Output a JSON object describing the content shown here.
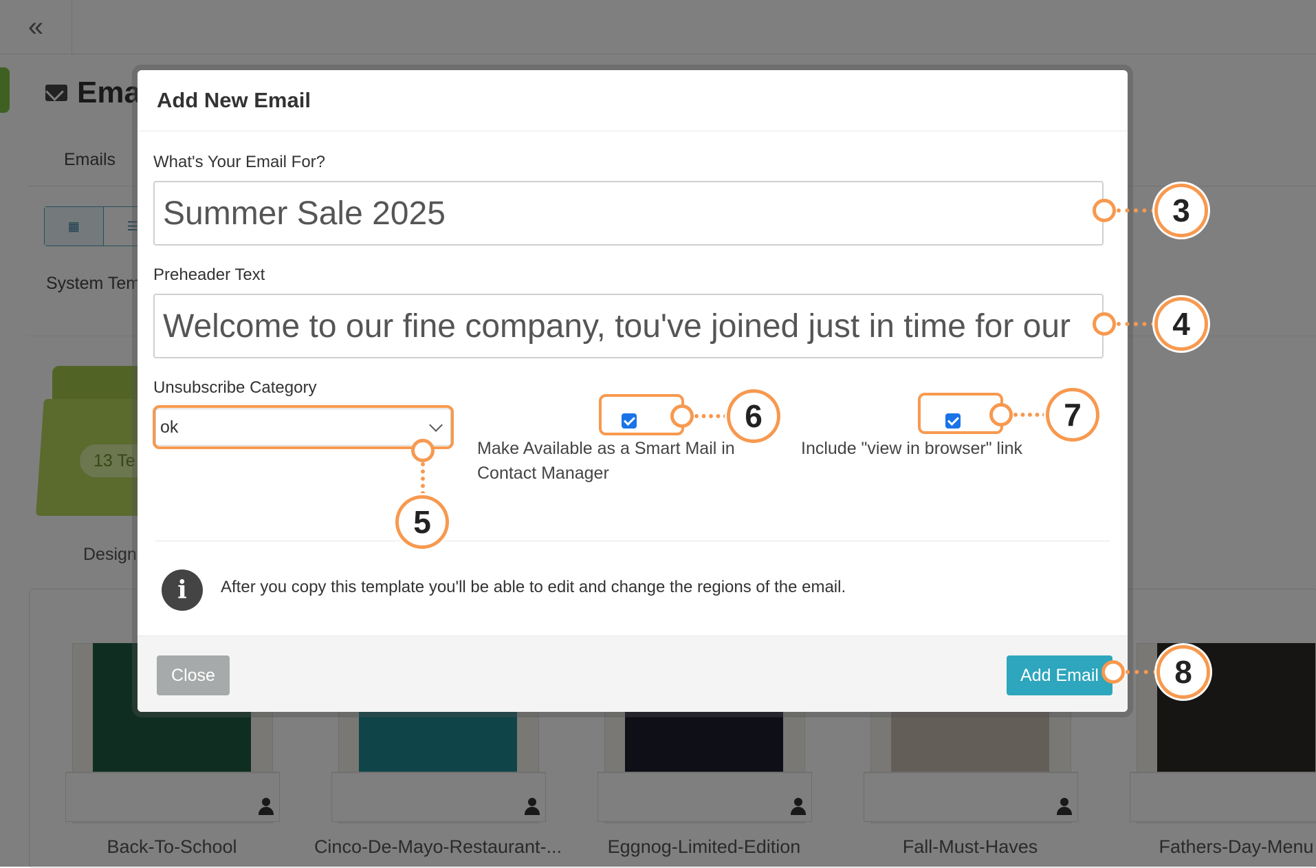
{
  "background": {
    "collapse_icon": "«",
    "page_title": "Ema",
    "tab_emails": "Emails",
    "system_templates": "System Tem",
    "folder_badge": "13 Te",
    "folder_label": "Design",
    "templates": [
      {
        "title": "Back-To-School"
      },
      {
        "title": "Cinco-De-Mayo-Restaurant-..."
      },
      {
        "title": "Eggnog-Limited-Edition"
      },
      {
        "title": "Fall-Must-Haves"
      },
      {
        "title": "Fathers-Day-Menu"
      }
    ]
  },
  "modal": {
    "title": "Add New Email",
    "email_for_label": "What's Your Email For?",
    "email_for_value": "Summer Sale 2025",
    "preheader_label": "Preheader Text",
    "preheader_value": "Welcome to our fine company, tou've joined just in time for our",
    "unsubscribe_label": "Unsubscribe Category",
    "unsubscribe_value": "ok",
    "smart_mail_label": "Make Available as a Smart Mail in Contact Manager",
    "smart_mail_checked": true,
    "view_browser_label": "Include \"view in browser\" link",
    "view_browser_checked": true,
    "info_text": "After you copy this template you'll be able to edit and change the regions of the email.",
    "close_label": "Close",
    "add_label": "Add Email"
  },
  "callouts": [
    "3",
    "4",
    "5",
    "6",
    "7",
    "8"
  ],
  "colors": {
    "accent": "#2ea6bd",
    "callout": "#f7994f",
    "checkbox": "#1a73e8",
    "close_button": "#a7aaaa"
  }
}
